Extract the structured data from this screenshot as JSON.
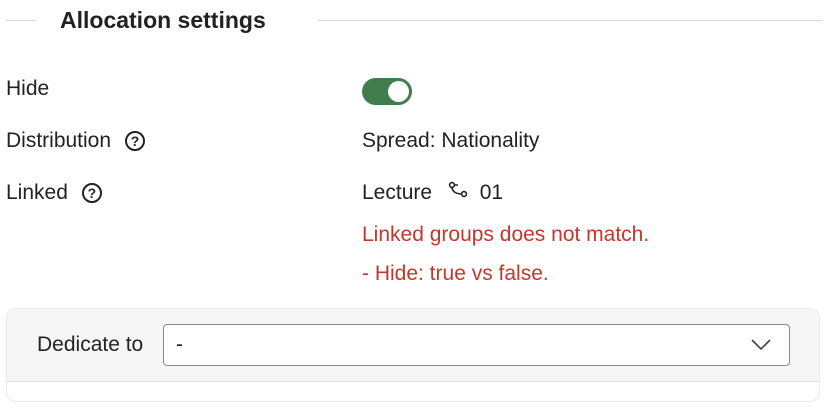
{
  "section": {
    "title": "Allocation settings"
  },
  "rows": {
    "hide": {
      "label": "Hide",
      "enabled": true
    },
    "distribution": {
      "label": "Distribution",
      "value": "Spread: Nationality"
    },
    "linked": {
      "label": "Linked",
      "value_prefix": "Lecture",
      "value_suffix": "01",
      "errors": [
        "Linked groups does not match.",
        "- Hide: true vs false."
      ]
    }
  },
  "dedicate": {
    "label": "Dedicate to",
    "selected": "-"
  },
  "colors": {
    "toggle_on": "#3f7d4c",
    "error": "#c0392b"
  },
  "icons": {
    "help": "help-circle-icon",
    "link": "link-branch-icon",
    "dropdown": "chevron-down-icon"
  }
}
